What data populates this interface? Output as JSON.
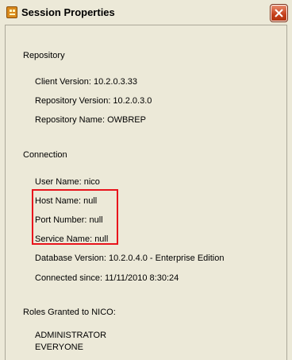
{
  "window": {
    "title": "Session Properties"
  },
  "repository": {
    "heading": "Repository",
    "client_version": "Client Version: 10.2.0.3.33",
    "repository_version": "Repository Version: 10.2.0.3.0",
    "repository_name": "Repository Name: OWBREP"
  },
  "connection": {
    "heading": "Connection",
    "user_name": "User Name: nico",
    "host_name": "Host Name: null",
    "port_number": "Port Number: null",
    "service_name": "Service Name: null",
    "database_version": "Database Version: 10.2.0.4.0 - Enterprise Edition",
    "connected_since": "Connected since: 11/11/2010 8:30:24"
  },
  "roles": {
    "heading": "Roles Granted to NICO:",
    "items": [
      "ADMINISTRATOR",
      "EVERYONE"
    ]
  },
  "colors": {
    "highlight_box": "#e8141c",
    "close_button": "#c4401b",
    "dialog_background": "#ece9d8"
  }
}
